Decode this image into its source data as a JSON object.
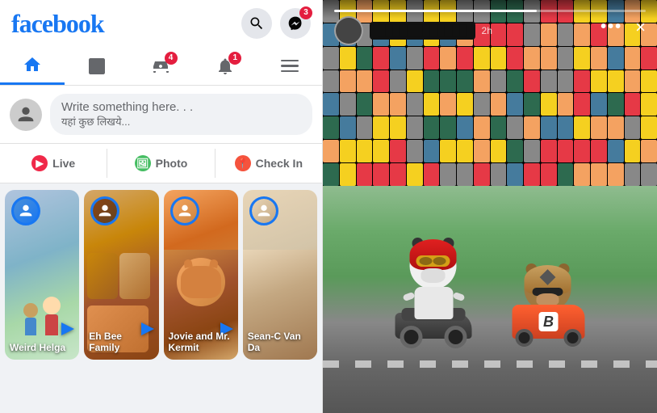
{
  "app": {
    "name": "facebook",
    "logo": "facebook"
  },
  "header": {
    "search_label": "Search",
    "messenger_label": "Messenger",
    "messenger_badge": "3"
  },
  "nav": {
    "tabs": [
      {
        "id": "home",
        "label": "Home",
        "active": true
      },
      {
        "id": "video",
        "label": "Video",
        "active": false
      },
      {
        "id": "marketplace",
        "label": "Marketplace",
        "active": false,
        "badge": "4"
      },
      {
        "id": "notifications",
        "label": "Notifications",
        "active": false,
        "badge": "1"
      },
      {
        "id": "menu",
        "label": "Menu",
        "active": false
      }
    ]
  },
  "post_box": {
    "placeholder_line1": "Write something here. . .",
    "placeholder_line2": "यहां कुछ लिखये..."
  },
  "action_buttons": [
    {
      "id": "live",
      "label": "Live",
      "icon": "live-icon"
    },
    {
      "id": "photo",
      "label": "Photo",
      "icon": "photo-icon"
    },
    {
      "id": "checkin",
      "label": "Check In",
      "icon": "checkin-icon"
    }
  ],
  "stories": [
    {
      "id": 1,
      "label": "Weird Helga",
      "has_arrow": true
    },
    {
      "id": 2,
      "label": "Eh Bee Family",
      "has_arrow": true
    },
    {
      "id": 3,
      "label": "Jovie and Mr. Kermit",
      "has_arrow": true
    },
    {
      "id": 4,
      "label": "Sean-C Van Da",
      "has_arrow": false
    }
  ],
  "story_viewer": {
    "username": "██████████████",
    "time": "2h",
    "dots_label": "•••",
    "close_label": "×",
    "progress": 65,
    "characters": [
      {
        "id": "panda",
        "type": "panda_motorcycle"
      },
      {
        "id": "bear",
        "type": "bear_kart",
        "number": "B"
      }
    ]
  },
  "colors": {
    "facebook_blue": "#1877f2",
    "live_red": "#f02849",
    "photo_green": "#45bd62",
    "checkin_red": "#f5533d",
    "badge_red": "#e41e3f",
    "bg_grey": "#f0f2f5"
  }
}
